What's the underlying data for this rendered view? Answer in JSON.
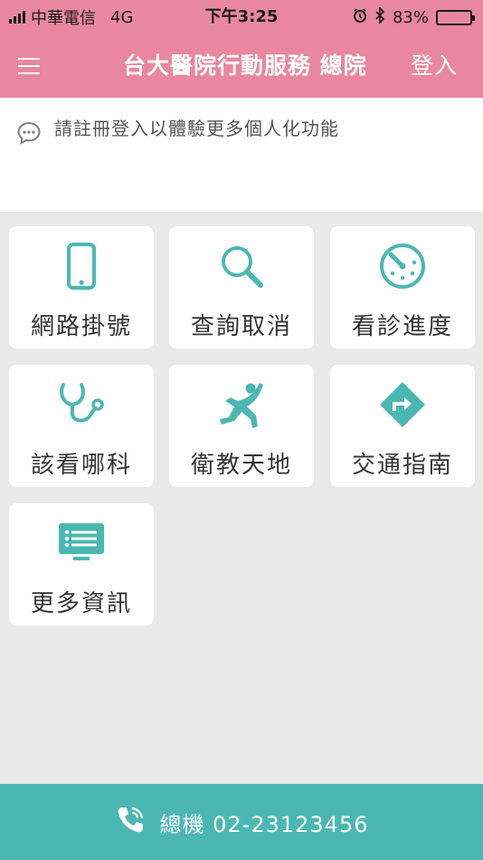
{
  "status_bar": {
    "carrier": "中華電信",
    "network": "4G",
    "time": "下午3:25",
    "battery": "83%",
    "battery_level": 0.83
  },
  "nav": {
    "title": "台大醫院行動服務 總院",
    "login": "登入"
  },
  "notice": {
    "text": "請註冊登入以體驗更多個人化功能"
  },
  "tiles": [
    {
      "label": "網路掛號",
      "icon": "phone-icon"
    },
    {
      "label": "查詢取消",
      "icon": "search-icon"
    },
    {
      "label": "看診進度",
      "icon": "progress-clock-icon"
    },
    {
      "label": "該看哪科",
      "icon": "stethoscope-icon"
    },
    {
      "label": "衛教天地",
      "icon": "runner-icon"
    },
    {
      "label": "交通指南",
      "icon": "directions-icon"
    },
    {
      "label": "更多資訊",
      "icon": "monitor-icon"
    }
  ],
  "bottom": {
    "label": "總機 02-23123456",
    "icon": "phone-call-icon"
  },
  "colors": {
    "header": "#e8879f",
    "accent": "#4bb7b3",
    "background": "#e9e9e9"
  }
}
